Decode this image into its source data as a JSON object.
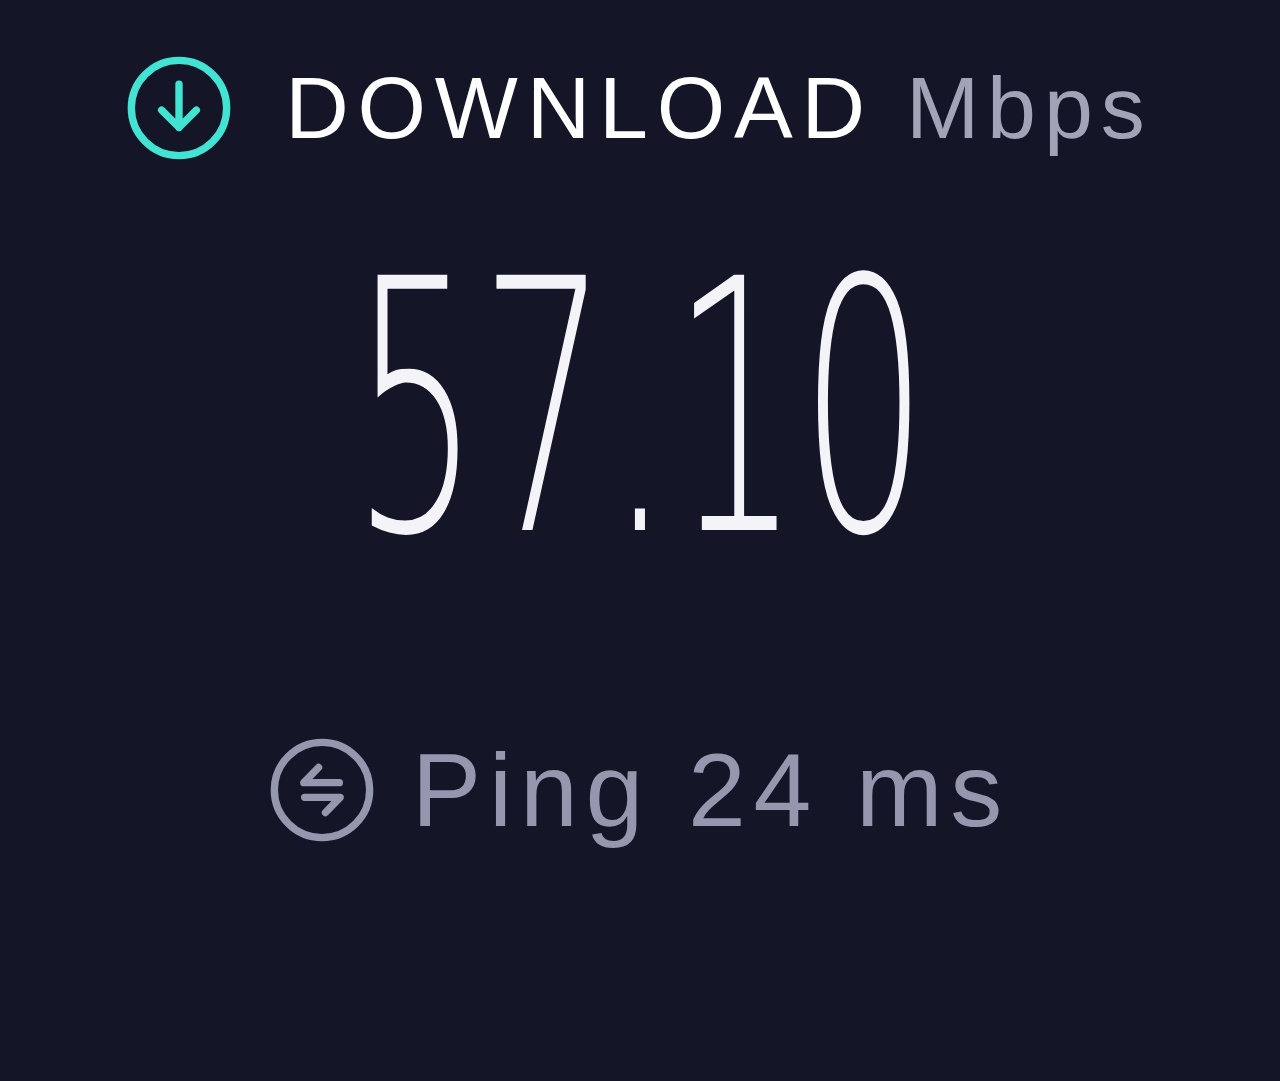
{
  "header": {
    "title": "DOWNLOAD",
    "unit": "Mbps"
  },
  "speed": {
    "value": "57.10"
  },
  "ping": {
    "text": "Ping 24 ms"
  }
}
